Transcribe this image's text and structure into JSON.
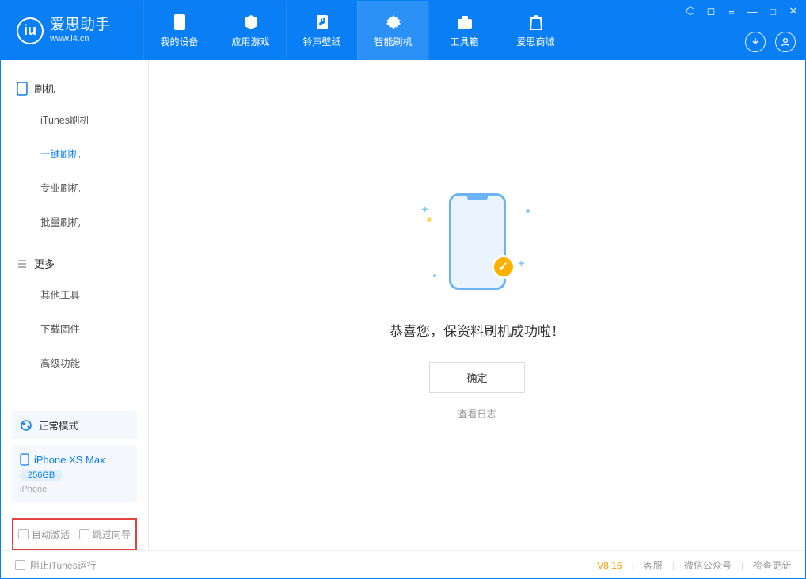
{
  "app": {
    "name": "爱思助手",
    "url": "www.i4.cn"
  },
  "tabs": [
    {
      "label": "我的设备"
    },
    {
      "label": "应用游戏"
    },
    {
      "label": "铃声壁纸"
    },
    {
      "label": "智能刷机"
    },
    {
      "label": "工具箱"
    },
    {
      "label": "爱思商城"
    }
  ],
  "sidebar": {
    "group1_label": "刷机",
    "items1": [
      {
        "label": "iTunes刷机"
      },
      {
        "label": "一键刷机"
      },
      {
        "label": "专业刷机"
      },
      {
        "label": "批量刷机"
      }
    ],
    "group2_label": "更多",
    "items2": [
      {
        "label": "其他工具"
      },
      {
        "label": "下载固件"
      },
      {
        "label": "高级功能"
      }
    ],
    "mode": "正常模式",
    "device_name": "iPhone XS Max",
    "device_capacity": "256GB",
    "device_type": "iPhone",
    "chk1": "自动激活",
    "chk2": "跳过向导"
  },
  "main": {
    "success": "恭喜您，保资料刷机成功啦！",
    "ok": "确定",
    "log": "查看日志"
  },
  "footer": {
    "stop_itunes": "阻止iTunes运行",
    "version": "V8.16",
    "link1": "客服",
    "link2": "微信公众号",
    "link3": "检查更新"
  }
}
